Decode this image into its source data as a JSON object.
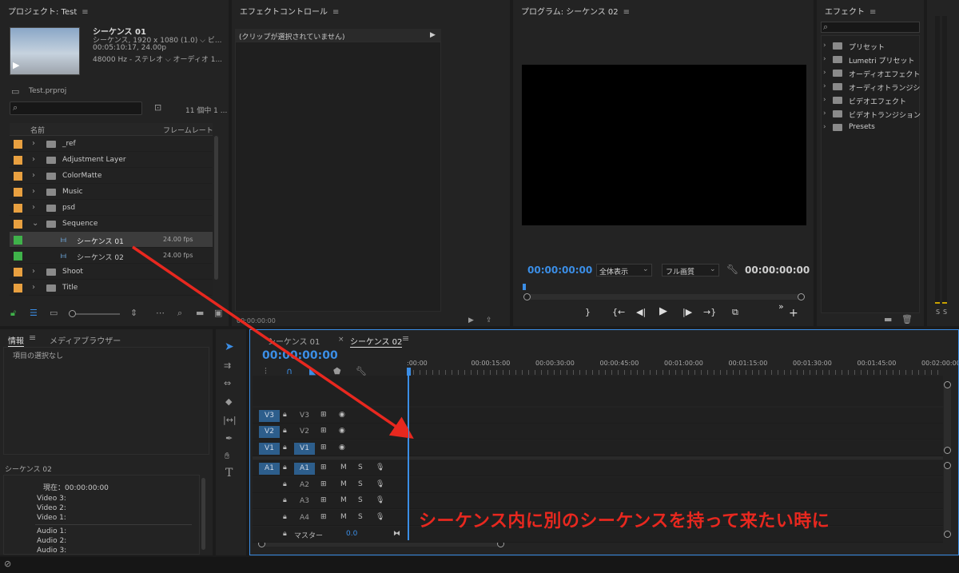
{
  "project": {
    "title": "プロジェクト: Test",
    "seq_name": "シーケンス 01",
    "seq_line1": "シーケンス, 1920 x 1080 (1.0) ⌵ ビ...",
    "seq_line2": "00:05:10:17, 24.00p",
    "seq_line3": "48000 Hz - ステレオ ⌵ オーディオ 1...",
    "file": "Test.prproj",
    "count": "11 個中 1 ...",
    "col_name": "名前",
    "col_fps": "フレームレート",
    "items": [
      {
        "name": "_ref",
        "fps": "",
        "color": "#e8a040",
        "type": "folder",
        "expand": "›"
      },
      {
        "name": "Adjustment Layer",
        "fps": "",
        "color": "#e8a040",
        "type": "folder",
        "expand": "›"
      },
      {
        "name": "ColorMatte",
        "fps": "",
        "color": "#e8a040",
        "type": "folder",
        "expand": "›"
      },
      {
        "name": "Music",
        "fps": "",
        "color": "#e8a040",
        "type": "folder",
        "expand": "›"
      },
      {
        "name": "psd",
        "fps": "",
        "color": "#e8a040",
        "type": "folder",
        "expand": "›"
      },
      {
        "name": "Sequence",
        "fps": "",
        "color": "#e8a040",
        "type": "folder",
        "expand": "⌄"
      },
      {
        "name": "シーケンス 01",
        "fps": "24.00 fps",
        "color": "#3fb24a",
        "type": "seq",
        "expand": ""
      },
      {
        "name": "シーケンス 02",
        "fps": "24.00 fps",
        "color": "#3fb24a",
        "type": "seq",
        "expand": ""
      },
      {
        "name": "Shoot",
        "fps": "",
        "color": "#e8a040",
        "type": "folder",
        "expand": "›"
      },
      {
        "name": "Title",
        "fps": "",
        "color": "#e8a040",
        "type": "folder",
        "expand": "›"
      }
    ]
  },
  "effect_controls": {
    "title": "エフェクトコントロール",
    "no_clip": "(クリップが選択されていません)",
    "tc": "00:00:00:00"
  },
  "program": {
    "title": "プログラム: シーケンス 02",
    "tc_left": "00:00:00:00",
    "zoom": "全体表示",
    "quality": "フル画質",
    "tc_right": "00:00:00:00"
  },
  "effects": {
    "title": "エフェクト",
    "items": [
      "プリセット",
      "Lumetri プリセット",
      "オーディオエフェクト",
      "オーディオトランジシ",
      "ビデオエフェクト",
      "ビデオトランジション",
      "Presets"
    ]
  },
  "info": {
    "tab_info": "情報",
    "tab_media": "メディアブラウザー",
    "no_selection": "項目の選択なし",
    "seq": "シーケンス 02",
    "now": "現在：00:00:00:00",
    "video": [
      "Video 3:",
      "Video 2:",
      "Video 1:"
    ],
    "audio": [
      "Audio 1:",
      "Audio 2:",
      "Audio 3:"
    ]
  },
  "timeline": {
    "tab1": "シーケンス 01",
    "tab2": "シーケンス 02",
    "tc": "00:00:00:00",
    "ruler": [
      ":00:00",
      "00:00:15:00",
      "00:00:30:00",
      "00:00:45:00",
      "00:01:00:00",
      "00:01:15:00",
      "00:01:30:00",
      "00:01:45:00",
      "00:02:00:00"
    ],
    "vtracks": [
      {
        "src": "V3",
        "name": "V3"
      },
      {
        "src": "V2",
        "name": "V2"
      },
      {
        "src": "V1",
        "name": "V1"
      }
    ],
    "atracks": [
      {
        "src": "A1",
        "name": "A1"
      },
      {
        "src": "",
        "name": "A2"
      },
      {
        "src": "",
        "name": "A3"
      },
      {
        "src": "",
        "name": "A4"
      }
    ],
    "master": "マスター",
    "master_val": "0.0",
    "m": "M",
    "s": "S"
  },
  "meter": {
    "s1": "S",
    "s2": "S"
  },
  "annotation": "シーケンス内に別のシーケンスを持って来たい時に",
  "colors": {
    "accent": "#3b8ee6",
    "annotation": "#e8281f",
    "panel": "#232323"
  }
}
